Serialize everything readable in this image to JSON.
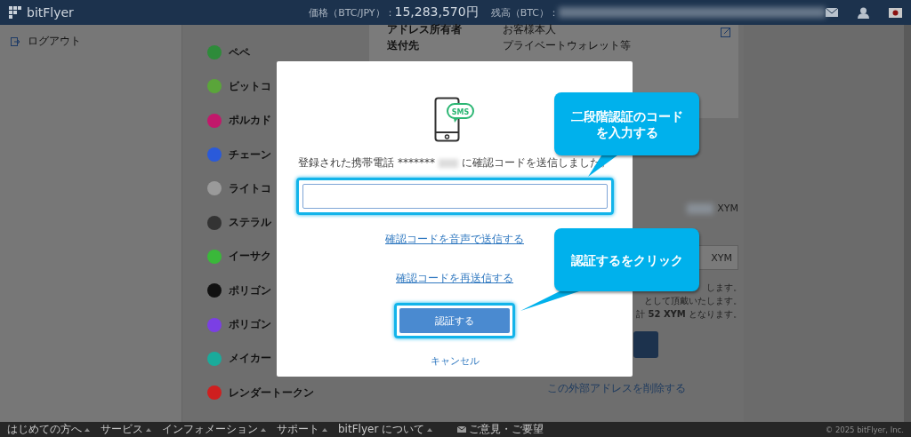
{
  "header": {
    "logo": "bitFlyer",
    "price_label": "価格（BTC/JPY）：",
    "price": "15,283,570円",
    "balance_label": "残高（BTC）："
  },
  "sidebar": {
    "items": [
      {
        "label": "ログアウト"
      }
    ]
  },
  "coins": [
    {
      "name": "ペペ",
      "color": "#2e8b3a"
    },
    {
      "name": "ビットコ",
      "color": "#5aa53a"
    },
    {
      "name": "ポルカド",
      "color": "#c2186b"
    },
    {
      "name": "チェーン",
      "color": "#2a5ada"
    },
    {
      "name": "ライトコ",
      "color": "#9a9a9a"
    },
    {
      "name": "ステラル",
      "color": "#333333"
    },
    {
      "name": "イーサク",
      "color": "#3ab83a"
    },
    {
      "name": "ポリゴン",
      "color": "#111111"
    },
    {
      "name": "ポリゴン",
      "color": "#7b3fe4"
    },
    {
      "name": "メイカー",
      "color": "#1aab9b"
    },
    {
      "name": "レンダートークン",
      "color": "#cf1f1f"
    }
  ],
  "details": {
    "rows": [
      {
        "label": "アドレス所有者",
        "value": "お客様本人"
      },
      {
        "label": "送付先",
        "value": "プライベートウォレット等"
      }
    ],
    "amount_unit": "XYM",
    "fee_unit": "XYM",
    "notes": [
      "します。",
      "として頂戴いたします。",
      "計 **52 XYM** となります。"
    ],
    "delete_link": "この外部アドレスを削除する"
  },
  "modal": {
    "icon_text": "SMS",
    "message_before": "登録された携帯電話 *******",
    "message_after": "に確認コードを送信しました。",
    "links": [
      "確認コードを音声で送信する",
      "確認コードを再送信する"
    ],
    "submit": "認証する",
    "cancel": "キャンセル"
  },
  "callouts": [
    {
      "kind": "pointer",
      "text": "二段階認証のコードを入力する"
    },
    {
      "kind": "line",
      "text": "認証するをクリック"
    }
  ],
  "footer": {
    "menu": [
      "はじめての方へ",
      "サービス",
      "インフォメーション",
      "サポート",
      "bitFlyer について"
    ],
    "feedback": "ご意見・ご要望",
    "copyright": "© 2025 bitFlyer, Inc."
  }
}
